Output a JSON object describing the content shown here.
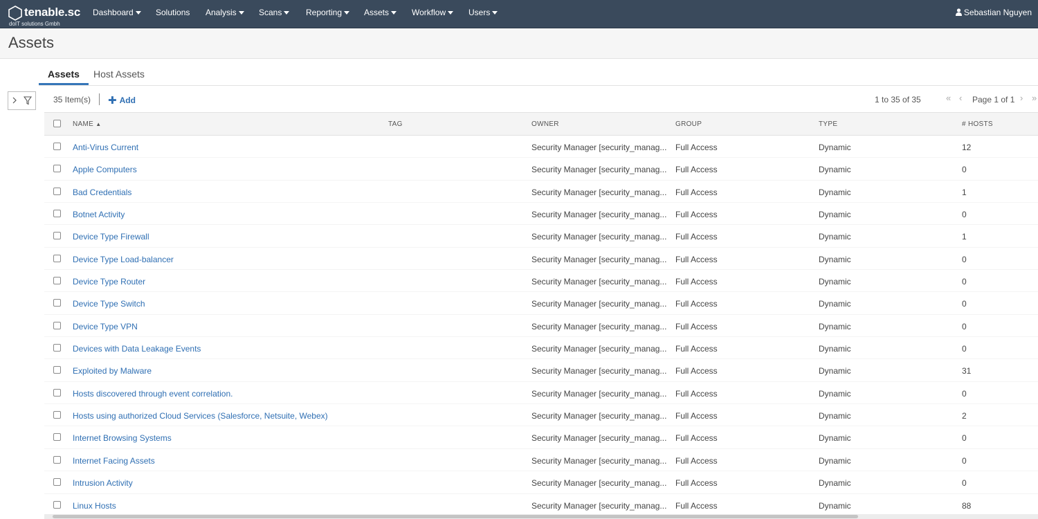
{
  "brand": {
    "logo_text": "tenable.sc",
    "subtitle": "doIT solutions Gmbh"
  },
  "nav": {
    "items": [
      {
        "label": "Dashboard",
        "dropdown": true
      },
      {
        "label": "Solutions",
        "dropdown": false
      },
      {
        "label": "Analysis",
        "dropdown": true
      },
      {
        "label": "Scans",
        "dropdown": true
      },
      {
        "label": "Reporting",
        "dropdown": true
      },
      {
        "label": "Assets",
        "dropdown": true
      },
      {
        "label": "Workflow",
        "dropdown": true
      },
      {
        "label": "Users",
        "dropdown": true
      }
    ],
    "user_name": "Sebastian Nguyen"
  },
  "page": {
    "title": "Assets"
  },
  "tabs": [
    {
      "label": "Assets",
      "active": true
    },
    {
      "label": "Host Assets",
      "active": false
    }
  ],
  "toolbar": {
    "item_count": "35 Item(s)",
    "add_label": "Add",
    "range_text": "1 to 35 of 35",
    "page_text": "Page 1 of 1"
  },
  "table": {
    "columns": [
      "NAME",
      "TAG",
      "OWNER",
      "GROUP",
      "TYPE",
      "# HOSTS"
    ],
    "sort_column": "NAME",
    "sort_direction": "ascending",
    "rows": [
      {
        "name": "Anti-Virus Current",
        "tag": "",
        "owner": "Security Manager [security_manag...",
        "group": "Full Access",
        "type": "Dynamic",
        "hosts": "12"
      },
      {
        "name": "Apple Computers",
        "tag": "",
        "owner": "Security Manager [security_manag...",
        "group": "Full Access",
        "type": "Dynamic",
        "hosts": "0"
      },
      {
        "name": "Bad Credentials",
        "tag": "",
        "owner": "Security Manager [security_manag...",
        "group": "Full Access",
        "type": "Dynamic",
        "hosts": "1"
      },
      {
        "name": "Botnet Activity",
        "tag": "",
        "owner": "Security Manager [security_manag...",
        "group": "Full Access",
        "type": "Dynamic",
        "hosts": "0"
      },
      {
        "name": "Device Type Firewall",
        "tag": "",
        "owner": "Security Manager [security_manag...",
        "group": "Full Access",
        "type": "Dynamic",
        "hosts": "1"
      },
      {
        "name": "Device Type Load-balancer",
        "tag": "",
        "owner": "Security Manager [security_manag...",
        "group": "Full Access",
        "type": "Dynamic",
        "hosts": "0"
      },
      {
        "name": "Device Type Router",
        "tag": "",
        "owner": "Security Manager [security_manag...",
        "group": "Full Access",
        "type": "Dynamic",
        "hosts": "0"
      },
      {
        "name": "Device Type Switch",
        "tag": "",
        "owner": "Security Manager [security_manag...",
        "group": "Full Access",
        "type": "Dynamic",
        "hosts": "0"
      },
      {
        "name": "Device Type VPN",
        "tag": "",
        "owner": "Security Manager [security_manag...",
        "group": "Full Access",
        "type": "Dynamic",
        "hosts": "0"
      },
      {
        "name": "Devices with Data Leakage Events",
        "tag": "",
        "owner": "Security Manager [security_manag...",
        "group": "Full Access",
        "type": "Dynamic",
        "hosts": "0"
      },
      {
        "name": "Exploited by Malware",
        "tag": "",
        "owner": "Security Manager [security_manag...",
        "group": "Full Access",
        "type": "Dynamic",
        "hosts": "31"
      },
      {
        "name": "Hosts discovered through event correlation.",
        "tag": "",
        "owner": "Security Manager [security_manag...",
        "group": "Full Access",
        "type": "Dynamic",
        "hosts": "0"
      },
      {
        "name": "Hosts using authorized Cloud Services (Salesforce, Netsuite, Webex)",
        "tag": "",
        "owner": "Security Manager [security_manag...",
        "group": "Full Access",
        "type": "Dynamic",
        "hosts": "2"
      },
      {
        "name": "Internet Browsing Systems",
        "tag": "",
        "owner": "Security Manager [security_manag...",
        "group": "Full Access",
        "type": "Dynamic",
        "hosts": "0"
      },
      {
        "name": "Internet Facing Assets",
        "tag": "",
        "owner": "Security Manager [security_manag...",
        "group": "Full Access",
        "type": "Dynamic",
        "hosts": "0"
      },
      {
        "name": "Intrusion Activity",
        "tag": "",
        "owner": "Security Manager [security_manag...",
        "group": "Full Access",
        "type": "Dynamic",
        "hosts": "0"
      },
      {
        "name": "Linux Hosts",
        "tag": "",
        "owner": "Security Manager [security_manag...",
        "group": "Full Access",
        "type": "Dynamic",
        "hosts": "88"
      }
    ]
  },
  "colors": {
    "nav_background": "#3a4a5c",
    "link": "#2f6fb3",
    "active_tab_underline": "#3576b8"
  }
}
